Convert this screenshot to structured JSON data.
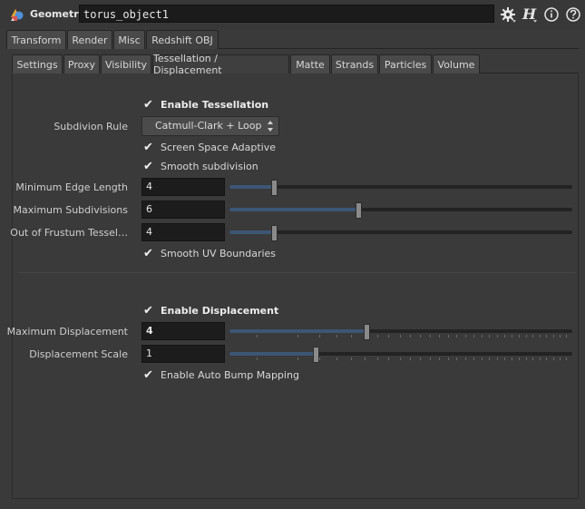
{
  "header": {
    "node_type": "Geometry",
    "node_name": "torus_object1",
    "icons": [
      "gear-icon",
      "houdini-help-icon",
      "info-icon",
      "help-icon"
    ]
  },
  "tabs_primary": [
    "Transform",
    "Render",
    "Misc",
    "Redshift OBJ"
  ],
  "tabs_primary_active": "Redshift OBJ",
  "tabs_secondary": [
    "Settings",
    "Proxy",
    "Visibility",
    "Tessellation / Displacement",
    "Matte",
    "Strands",
    "Particles",
    "Volume"
  ],
  "tabs_secondary_active": "Tessellation / Displacement",
  "tessellation": {
    "enable_label": "Enable Tessellation",
    "enable_checked": true,
    "subdiv_rule_label": "Subdivion Rule",
    "subdiv_rule_value": "Catmull-Clark + Loop",
    "screen_space_label": "Screen Space Adaptive",
    "screen_space_checked": true,
    "smooth_subdiv_label": "Smooth subdivision",
    "smooth_subdiv_checked": true,
    "min_edge_label": "Minimum Edge Length",
    "min_edge_value": "4",
    "min_edge_slider_fraction": 0.13,
    "max_subdiv_label": "Maximum Subdivisions",
    "max_subdiv_value": "6",
    "max_subdiv_slider_fraction": 0.375,
    "out_frustum_label": "Out of Frustum Tessel…",
    "out_frustum_value": "4",
    "out_frustum_slider_fraction": 0.13,
    "smooth_uv_label": "Smooth UV Boundaries",
    "smooth_uv_checked": true
  },
  "displacement": {
    "enable_label": "Enable Displacement",
    "enable_checked": true,
    "max_disp_label": "Maximum Displacement",
    "max_disp_value": "4",
    "max_disp_slider_fraction": 0.4,
    "disp_scale_label": "Displacement Scale",
    "disp_scale_value": "1",
    "disp_scale_slider_fraction": 0.25,
    "auto_bump_label": "Enable Auto Bump Mapping",
    "auto_bump_checked": true
  },
  "colors": {
    "background": "#3a3a3a",
    "field_bg": "#1c1c1c",
    "slider_fill": "#3c5675"
  }
}
